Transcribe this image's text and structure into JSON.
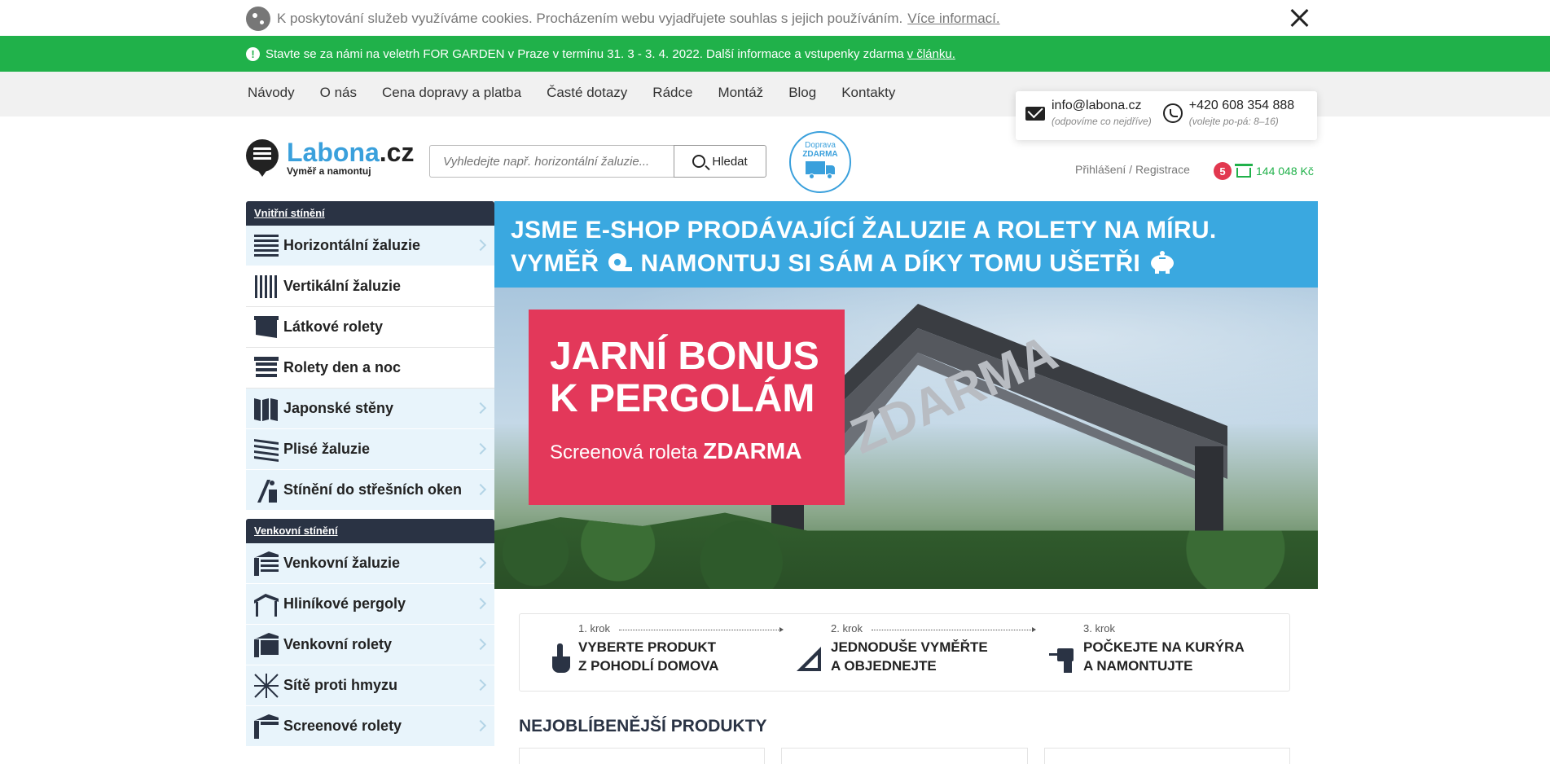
{
  "cookie_bar": {
    "text": "K poskytování služeb využíváme cookies. Procházením webu vyjadřujete souhlas s jejich používáním.",
    "link": "Více informací."
  },
  "promo_bar": {
    "text": "Stavte se za námi na veletrh FOR GARDEN v Praze v termínu 31. 3 - 3. 4. 2022. Další informace a vstupenky zdarma",
    "link": "v článku."
  },
  "top_nav": [
    "Návody",
    "O nás",
    "Cena dopravy a platba",
    "Časté dotazy",
    "Rádce",
    "Montáž",
    "Blog",
    "Kontakty"
  ],
  "contact": {
    "email": "info@labona.cz",
    "email_note": "(odpovíme co nejdříve)",
    "phone": "+420 608 354 888",
    "phone_note": "(volejte po-pá: 8–16)"
  },
  "logo": {
    "name": "Labona",
    "tld": ".cz",
    "tagline": "Vyměř a namontuj"
  },
  "search": {
    "placeholder": "Vyhledejte např. horizontální žaluzie...",
    "button": "Hledat"
  },
  "free_shipping": {
    "line1": "Doprava",
    "line2": "ZDARMA"
  },
  "account": {
    "login": "Přihlášení",
    "separator": " / ",
    "register": "Registrace"
  },
  "cart": {
    "count": "5",
    "total": "144 048 Kč"
  },
  "sidebar": {
    "indoor_heading": "Vnitřní stínění",
    "indoor": [
      {
        "label": "Horizontální žaluzie",
        "icon": "horizontal-blinds-icon",
        "chevron": true,
        "style": "blue"
      },
      {
        "label": "Vertikální žaluzie",
        "icon": "vertical-blinds-icon",
        "chevron": false,
        "style": "white"
      },
      {
        "label": "Látkové rolety",
        "icon": "fabric-roller-icon",
        "chevron": false,
        "style": "white"
      },
      {
        "label": "Rolety den a noc",
        "icon": "day-night-roller-icon",
        "chevron": false,
        "style": "white"
      },
      {
        "label": "Japonské stěny",
        "icon": "japanese-panel-icon",
        "chevron": true,
        "style": "blue"
      },
      {
        "label": "Plisé žaluzie",
        "icon": "pleated-blinds-icon",
        "chevron": true,
        "style": "blue"
      },
      {
        "label": "Stínění do střešních oken",
        "icon": "roof-window-icon",
        "chevron": true,
        "style": "blue"
      }
    ],
    "outdoor_heading": "Venkovní stínění",
    "outdoor": [
      {
        "label": "Venkovní žaluzie",
        "icon": "outdoor-blinds-icon",
        "chevron": true,
        "style": "blue"
      },
      {
        "label": "Hliníkové pergoly",
        "icon": "pergola-icon",
        "chevron": true,
        "style": "blue"
      },
      {
        "label": "Venkovní rolety",
        "icon": "outdoor-roller-icon",
        "chevron": true,
        "style": "blue"
      },
      {
        "label": "Sítě proti hmyzu",
        "icon": "insect-net-icon",
        "chevron": true,
        "style": "blue"
      },
      {
        "label": "Screenové rolety",
        "icon": "screen-roller-icon",
        "chevron": true,
        "style": "blue"
      }
    ]
  },
  "hero": {
    "line1": "JSME E-SHOP PRODÁVAJÍCÍ ŽALUZIE A ROLETY NA MÍRU.",
    "line2_a": "VYMĚŘ",
    "line2_b": "NAMONTUJ SI SÁM A DÍKY TOMU UŠETŘI",
    "banner_title1": "JARNÍ BONUS",
    "banner_title2": "K PERGOLÁM",
    "banner_sub": "Screenová roleta",
    "banner_sub_bold": "ZDARMA",
    "pergola_text": "ZDARMA"
  },
  "steps": [
    {
      "num": "1. krok",
      "line1": "VYBERTE PRODUKT",
      "line2": "Z POHODLÍ DOMOVA",
      "icon": "hand-pointer-icon"
    },
    {
      "num": "2. krok",
      "line1": "JEDNODUŠE VYMĚŘTE",
      "line2": "A OBJEDNEJTE",
      "icon": "measure-icon"
    },
    {
      "num": "3. krok",
      "line1": "POČKEJTE NA KURÝRA",
      "line2": "A NAMONTUJTE",
      "icon": "drill-icon"
    }
  ],
  "popular_title": "NEJOBLÍBENĚJŠÍ PRODUKTY"
}
